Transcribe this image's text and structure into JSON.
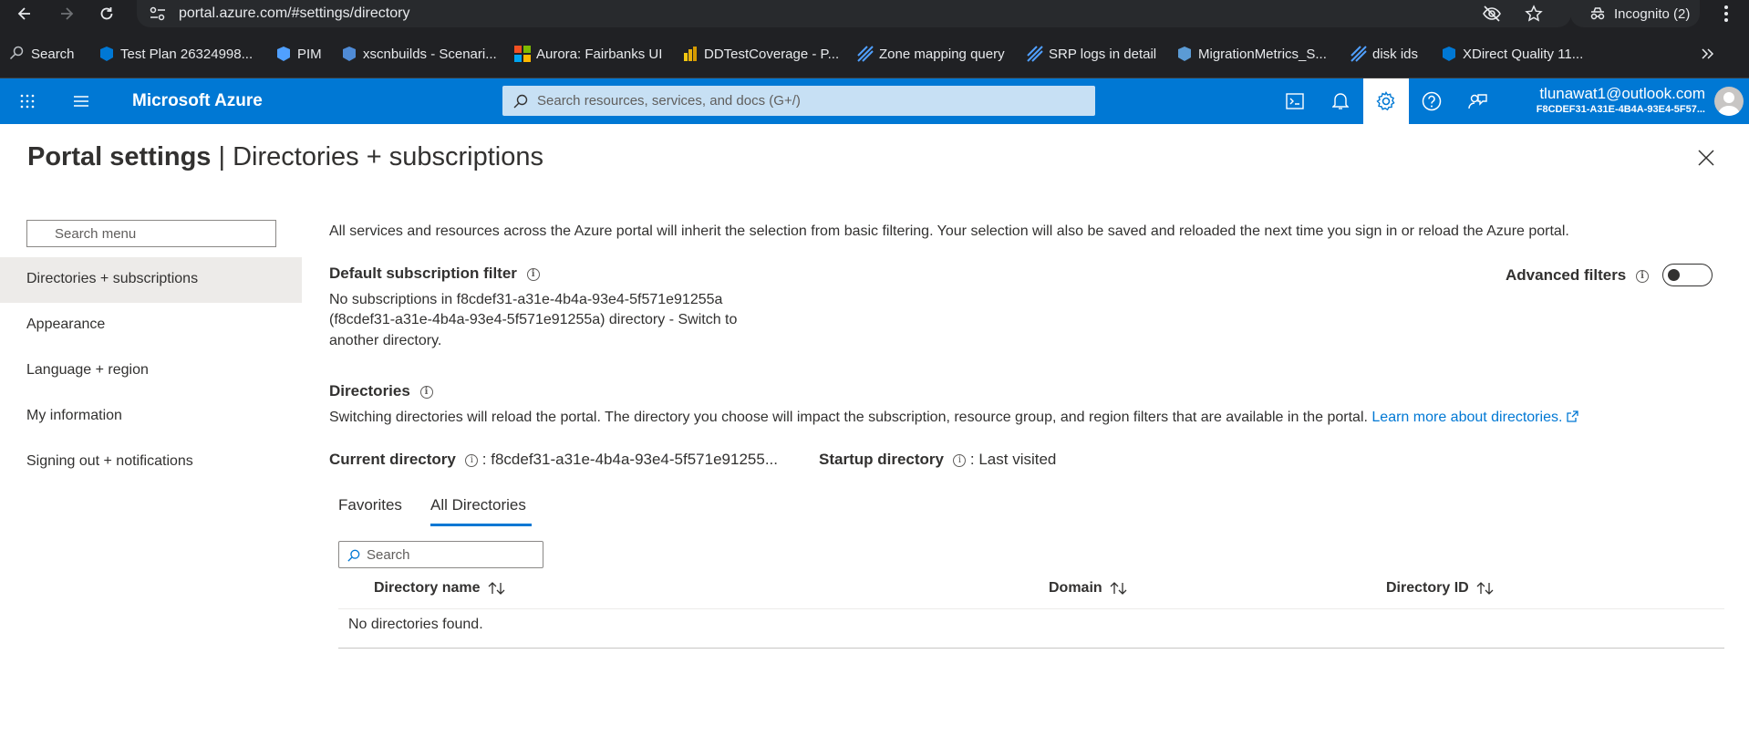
{
  "browser": {
    "url": "portal.azure.com/#settings/directory",
    "incognito_label": "Incognito (2)",
    "bookmarks": [
      {
        "label": "Search",
        "icon": "search-bookmark-icon",
        "color": "#8ab4f8"
      },
      {
        "label": "Test Plan 26324998...",
        "icon": "azure-devops-icon",
        "color": "#0078d4"
      },
      {
        "label": "PIM",
        "icon": "pim-icon",
        "color": "#50a0ff"
      },
      {
        "label": "xscnbuilds - Scenari...",
        "icon": "xscn-icon",
        "color": "#4f8bd6"
      },
      {
        "label": "Aurora: Fairbanks UI",
        "icon": "microsoft-logo-icon",
        "color": "#f25022"
      },
      {
        "label": "DDTestCoverage - P...",
        "icon": "powerbi-icon",
        "color": "#f2c811"
      },
      {
        "label": "Zone mapping query",
        "icon": "kusto-icon",
        "color": "#50a0ff"
      },
      {
        "label": "SRP logs in detail",
        "icon": "kusto-icon",
        "color": "#50a0ff"
      },
      {
        "label": "MigrationMetrics_S...",
        "icon": "migration-icon",
        "color": "#5b9bd5"
      },
      {
        "label": "disk ids",
        "icon": "kusto-icon",
        "color": "#50a0ff"
      },
      {
        "label": "XDirect Quality 11...",
        "icon": "azure-devops-icon",
        "color": "#0078d4"
      }
    ]
  },
  "azure": {
    "brand": "Microsoft Azure",
    "search_placeholder": "Search resources, services, and docs (G+/)",
    "account_email": "tlunawat1@outlook.com",
    "account_tenant": "F8CDEF31-A31E-4B4A-93E4-5F57...",
    "colors": {
      "brand_blue": "#0078d4",
      "search_bg": "#c7e0f4"
    }
  },
  "page": {
    "title_bold": "Portal settings",
    "title_rest": "Directories + subscriptions"
  },
  "sidebar": {
    "search_placeholder": "Search menu",
    "items": [
      {
        "label": "Directories + subscriptions",
        "selected": true
      },
      {
        "label": "Appearance"
      },
      {
        "label": "Language + region"
      },
      {
        "label": "My information"
      },
      {
        "label": "Signing out + notifications"
      }
    ]
  },
  "content": {
    "intro": "All services and resources across the Azure portal will inherit the selection from basic filtering. Your selection will also be saved and reloaded the next time you sign in or reload the Azure portal.",
    "default_filter_heading": "Default subscription filter",
    "advanced_filters_label": "Advanced filters",
    "no_subs_line1": "No subscriptions in f8cdef31-a31e-4b4a-93e4-5f571e91255a",
    "no_subs_line2": "(f8cdef31-a31e-4b4a-93e4-5f571e91255a) directory - Switch to",
    "no_subs_line3": "another directory.",
    "directories_heading": "Directories",
    "directories_desc": "Switching directories will reload the portal. The directory you choose will impact the subscription, resource group, and region filters that are available in the portal.",
    "learn_more": "Learn more about directories.",
    "current_directory_label": "Current directory",
    "current_directory_value": ": f8cdef31-a31e-4b4a-93e4-5f571e91255...",
    "startup_directory_label": "Startup directory",
    "startup_directory_value": ": Last visited",
    "tabs": [
      {
        "label": "Favorites"
      },
      {
        "label": "All Directories",
        "active": true
      }
    ],
    "search_placeholder": "Search",
    "table": {
      "columns": [
        "Directory name",
        "Domain",
        "Directory ID"
      ],
      "empty_message": "No directories found."
    }
  }
}
